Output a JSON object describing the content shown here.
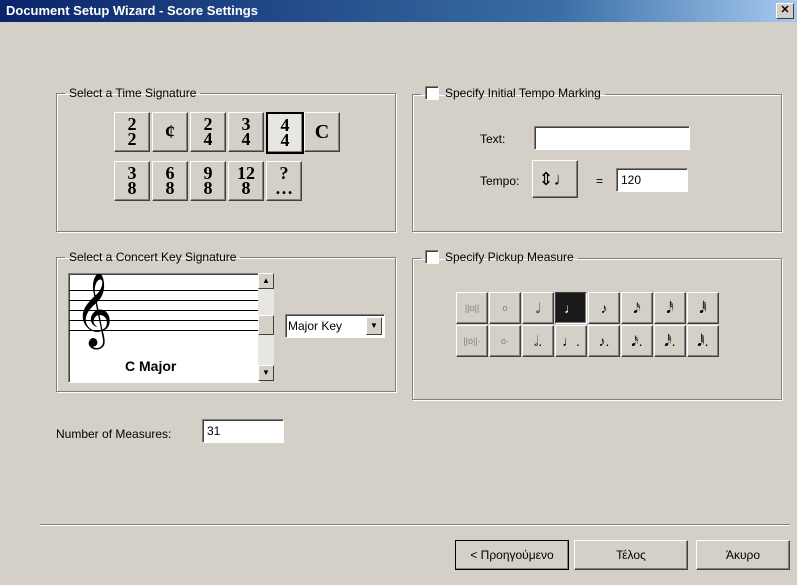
{
  "window": {
    "title": "Document Setup Wizard - Score Settings",
    "close_glyph": "✕"
  },
  "time_signature": {
    "legend": "Select a Time Signature",
    "row1": [
      {
        "n": "2",
        "d": "2"
      },
      {
        "sym": "¢"
      },
      {
        "n": "2",
        "d": "4"
      },
      {
        "n": "3",
        "d": "4"
      },
      {
        "n": "4",
        "d": "4",
        "selected": true
      },
      {
        "sym": "C"
      }
    ],
    "row2": [
      {
        "n": "3",
        "d": "8"
      },
      {
        "n": "6",
        "d": "8"
      },
      {
        "n": "9",
        "d": "8"
      },
      {
        "n": "12",
        "d": "8"
      },
      {
        "n": "?",
        "d": "…"
      }
    ]
  },
  "tempo": {
    "legend": "Specify Initial Tempo Marking",
    "checked": false,
    "text_label": "Text:",
    "text_value": "",
    "tempo_label": "Tempo:",
    "tempo_note_glyph": "⇕♩",
    "equals": "=",
    "tempo_value": "120"
  },
  "key_signature": {
    "legend": "Select a Concert Key Signature",
    "key_name": "C Major",
    "clef_glyph": "𝄞",
    "mode_select": "Major Key"
  },
  "pickup": {
    "legend": "Specify Pickup Measure",
    "checked": false,
    "row1": [
      "||o||",
      "o",
      "𝅗𝅥",
      "♩",
      "♪",
      "𝅘𝅥𝅯",
      "𝅘𝅥𝅰",
      "𝅘𝅥𝅱"
    ],
    "row2": [
      "||o||·",
      "o·",
      "𝅗𝅥.",
      "♩.",
      "♪.",
      "𝅘𝅥𝅯.",
      "𝅘𝅥𝅰.",
      "𝅘𝅥𝅱."
    ],
    "selected_index": 3
  },
  "measures": {
    "label": "Number of Measures:",
    "value": "31"
  },
  "footer": {
    "back": "< Προηγούμενο",
    "finish": "Τέλος",
    "cancel": "Άκυρο"
  }
}
